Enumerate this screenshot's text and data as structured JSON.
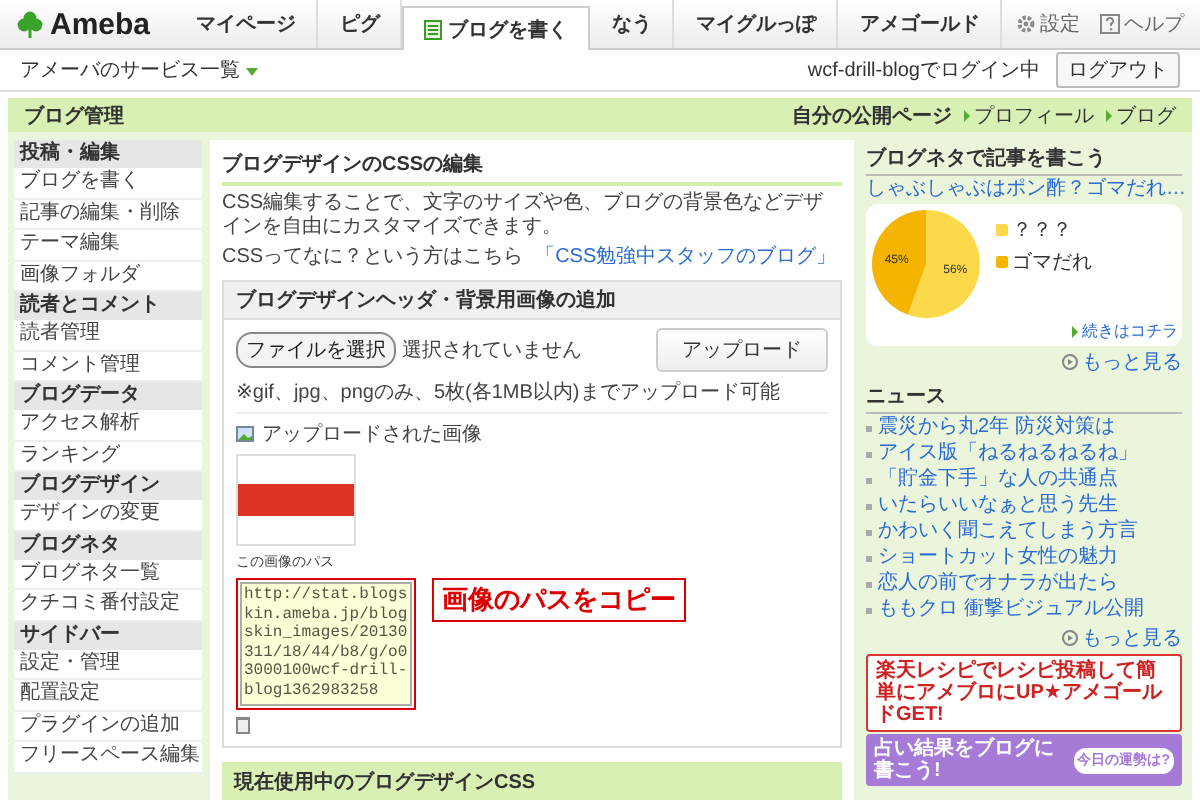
{
  "header": {
    "logo": "Ameba",
    "tabs": [
      {
        "label": "マイページ",
        "selected": false,
        "kind": "plain"
      },
      {
        "label": "ピグ",
        "selected": false,
        "kind": "plain"
      },
      {
        "label": "ブログを書く",
        "selected": true,
        "kind": "write"
      },
      {
        "label": "なう",
        "selected": false,
        "kind": "plain"
      },
      {
        "label": "マイグルっぽ",
        "selected": false,
        "kind": "plain"
      },
      {
        "label": "アメゴールド",
        "selected": false,
        "kind": "plain"
      }
    ],
    "links": [
      {
        "kind": "settings",
        "label": "設定"
      },
      {
        "kind": "help",
        "label": "ヘルプ"
      }
    ]
  },
  "subbar": {
    "services": "アメーバのサービス一覧",
    "login_status": "wcf-drill-blogでログイン中",
    "logout": "ログアウト"
  },
  "title_bar": {
    "title": "ブログ管理",
    "public_page": "自分の公開ページ",
    "links": [
      "プロフィール",
      "ブログ"
    ]
  },
  "sidebar": {
    "sections": [
      {
        "heading": "投稿・編集",
        "items": [
          "ブログを書く",
          "記事の編集・削除",
          "テーマ編集",
          "画像フォルダ"
        ]
      },
      {
        "heading": "読者とコメント",
        "items": [
          "読者管理",
          "コメント管理"
        ]
      },
      {
        "heading": "ブログデータ",
        "items": [
          "アクセス解析",
          "ランキング"
        ]
      },
      {
        "heading": "ブログデザイン",
        "items": [
          "デザインの変更"
        ]
      },
      {
        "heading": "ブログネタ",
        "items": [
          "ブログネタ一覧",
          "クチコミ番付設定"
        ]
      },
      {
        "heading": "サイドバー",
        "items": [
          "設定・管理",
          "配置設定",
          "プラグインの追加",
          "フリースペース編集"
        ]
      }
    ]
  },
  "main": {
    "title": "ブログデザインのCSSの編集",
    "description": "CSS編集することで、文字のサイズや色、ブログの背景色などデザインを自由にカスタマイズできます。",
    "help_prompt": "CSSってなに？という方はこちら",
    "help_link": "「CSS勉強中スタッフのブログ」",
    "upload": {
      "title": "ブログデザインヘッダ・背景用画像の追加",
      "file_button": "ファイルを選択",
      "file_status": "選択されていません",
      "upload_button": "アップロード",
      "note": "※gif、jpg、pngのみ、5枚(各1MB以内)までアップロード可能",
      "uploaded_label": "アップロードされた画像",
      "path_label": "この画像のパス",
      "path_value": "http://stat.blogskin.ameba.jp/blogskin_images/20130311/18/44/b8/g/o03000100wcf-drill-blog1362983258",
      "callout": "画像のパスをコピー"
    },
    "current": {
      "title": "現在使用中のブログデザインCSS"
    }
  },
  "right": {
    "neta": {
      "title": "ブログネタで記事を書こう",
      "topic": "しゃぶしゃぶはポン酢？ゴマだれ…",
      "chart_data": {
        "type": "pie",
        "categories": [
          "？？？",
          "ゴマだれ"
        ],
        "series": [
          {
            "values": [
              56,
              45
            ]
          }
        ],
        "colors": [
          "#fcd94a",
          "#f5b400"
        ],
        "value_labels": [
          "56%",
          "45%"
        ]
      },
      "continue": "続きはコチラ",
      "more": "もっと見る"
    },
    "news": {
      "title": "ニュース",
      "items": [
        "震災から丸2年 防災対策は",
        "アイス版「ねるねるねるね」",
        "「貯金下手」な人の共通点",
        "いたらいいなぁと思う先生",
        "かわいく聞こえてしまう方言",
        "ショートカット女性の魅力",
        "恋人の前でオナラが出たら",
        "ももクロ 衝撃ビジュアル公開"
      ],
      "more": "もっと見る"
    },
    "banners": [
      {
        "kind": "recipe",
        "text": "楽天レシピでレシピ投稿して簡単にアメブロにUP★アメゴールドGET!"
      },
      {
        "kind": "fortune",
        "text": "占い結果をブログに書こう!",
        "badge": "今日の運勢は?"
      }
    ]
  }
}
